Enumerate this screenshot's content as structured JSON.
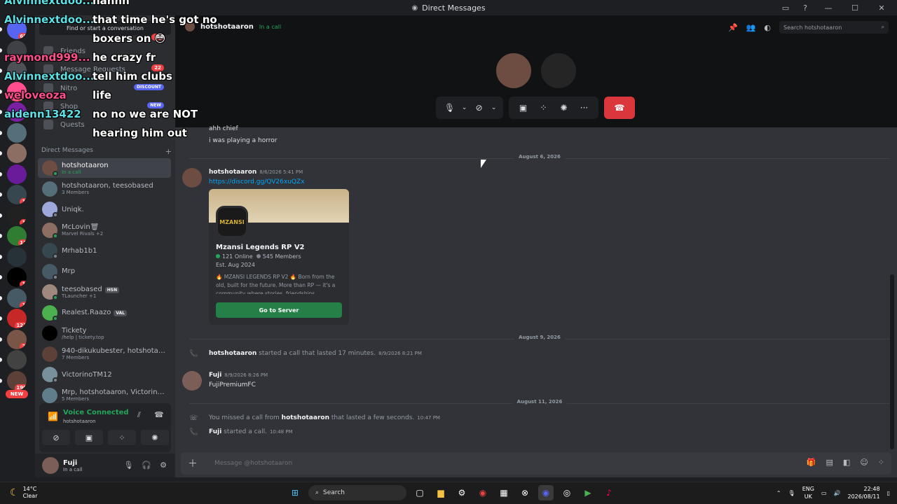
{
  "window": {
    "title": "Direct Messages"
  },
  "overlay_chat": [
    {
      "user": "Alvinnextdoo...",
      "msg": "hahhh",
      "user_color": "#5ce1e6"
    },
    {
      "user": "Alvinnextdoo...",
      "msg": "that time he's got no",
      "user_color": "#5ce1e6"
    },
    {
      "user": "",
      "msg": "boxers on 😳",
      "user_color": ""
    },
    {
      "user": "raymond999...",
      "msg": "he crazy fr",
      "user_color": "#ff4d8d"
    },
    {
      "user": "Alvinnextdoo...",
      "msg": "tell him clubs",
      "user_color": "#5ce1e6"
    },
    {
      "user": "weloveoza",
      "msg": "life",
      "user_color": "#ff4d8d"
    },
    {
      "user": "aidenn13422",
      "msg": "no no we are NOT",
      "user_color": "#5ce1e6"
    },
    {
      "user": "",
      "msg": "hearing him out",
      "user_color": ""
    }
  ],
  "rail": {
    "badges": [
      "65",
      "",
      "",
      "11",
      "",
      "",
      "",
      "",
      "1",
      "1",
      "13",
      "",
      "1",
      "1",
      "123",
      "2",
      "",
      "190"
    ],
    "new_label": "NEW"
  },
  "sidebar": {
    "find_placeholder": "Find or start a conversation",
    "nav": [
      {
        "label": "Friends",
        "badge": ""
      },
      {
        "label": "Message Requests",
        "badge": "22"
      },
      {
        "label": "Nitro",
        "badge": "",
        "tag": "DISCOUNT"
      },
      {
        "label": "Shop",
        "badge": "",
        "tag": "NEW"
      },
      {
        "label": "Quests",
        "badge": ""
      }
    ],
    "nav_badge_41": "41",
    "dm_header": "Direct Messages",
    "dm_add": "+",
    "dms": [
      {
        "name": "hotshotaaron",
        "sub": "In a call",
        "sub_green": true,
        "active": true,
        "avatar": "#6d4c41",
        "status": "online"
      },
      {
        "name": "hotshotaaron, teesobased",
        "sub": "3 Members",
        "avatar": "#546e7a",
        "status": "none"
      },
      {
        "name": "Uniqk.",
        "sub": "",
        "avatar": "#9fa8da",
        "status": "offline"
      },
      {
        "name": "McLovin🗑",
        "sub": "Marvel Rivals +2",
        "avatar": "#8d6e63",
        "status": "online"
      },
      {
        "name": "Mrhab1b1",
        "sub": "",
        "avatar": "#37474f",
        "status": "offline"
      },
      {
        "name": "Mrp",
        "sub": "",
        "avatar": "#455a64",
        "status": "offline"
      },
      {
        "name": "teesobased",
        "sub": "TLauncher +1",
        "tag": "HSN",
        "avatar": "#a1887f",
        "status": "online"
      },
      {
        "name": "Realest.Raazo",
        "sub": "",
        "tag": "VAL",
        "avatar": "#4caf50",
        "status": "online"
      },
      {
        "name": "Tickety",
        "sub": "/help | tickety.top",
        "avatar": "#000000",
        "status": "none"
      },
      {
        "name": "940-dikukubester, hotshotaaro...",
        "sub": "7 Members",
        "avatar": "#5d4037",
        "status": "none"
      },
      {
        "name": "VictorinoTM12",
        "sub": "",
        "avatar": "#78909c",
        "status": "offline"
      },
      {
        "name": "Mrp, hotshotaaron, VictorinoT...",
        "sub": "5 Members",
        "avatar": "#607d8b",
        "status": "none"
      }
    ]
  },
  "voice": {
    "title": "Voice Connected",
    "subtitle": "hotshotaaron"
  },
  "user": {
    "name": "Fuji",
    "status": "In a call"
  },
  "header": {
    "channel": "hotshotaaron",
    "status": "In a call",
    "search_placeholder": "Search hotshotaaron"
  },
  "messages": {
    "top_lines": [
      "ahh chief",
      "i was playing a horror"
    ],
    "date1": "August 6, 2026",
    "msg1": {
      "author": "hotshotaaron",
      "time": "8/6/2026 5:41 PM",
      "link": "https://discord.gg/QV26xuQZx"
    },
    "invite": {
      "icon_text": "MZANSI",
      "name": "Mzansi Legends RP V2",
      "online": "121 Online",
      "members": "545 Members",
      "est": "Est. Aug 2024",
      "desc": "🔥 MZANSI LEGENDS RP V2 🔥 Born from the old, built for the future. More than RP — it's a community where stories, friendships",
      "button": "Go to Server"
    },
    "date2": "August 9, 2026",
    "call1": {
      "author": "hotshotaaron",
      "text": "started a call that lasted 17 minutes.",
      "time": "8/9/2026 8:21 PM"
    },
    "msg2": {
      "author": "Fuji",
      "time": "8/9/2026 8:26 PM",
      "text": "FujiPremiumFC"
    },
    "date3": "August 11, 2026",
    "missed": {
      "prefix": "You missed a call from",
      "author": "hotshotaaron",
      "suffix": "that lasted a few seconds.",
      "time": "10:47 PM"
    },
    "call2": {
      "author": "Fuji",
      "text": "started a call.",
      "time": "10:48 PM"
    }
  },
  "composer": {
    "placeholder": "Message @hotshotaaron"
  },
  "taskbar": {
    "temp": "14°C",
    "weather": "Clear",
    "search": "Search",
    "lang": "ENG",
    "region": "UK",
    "time": "22:48",
    "date": "2026/08/11"
  }
}
